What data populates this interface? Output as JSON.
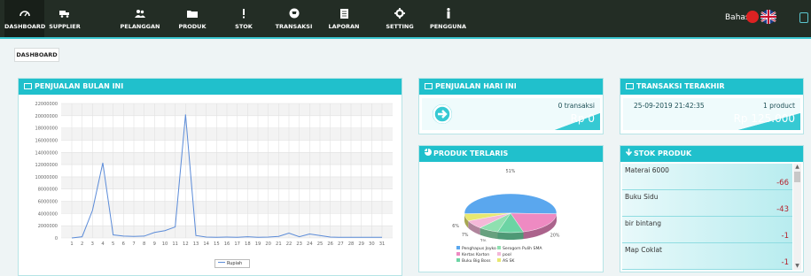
{
  "nav": {
    "items": [
      {
        "label": "DASHBOARD",
        "icon": "dashboard-icon"
      },
      {
        "label": "SUPPLIER",
        "icon": "truck-icon"
      },
      {
        "label": "PELANGGAN",
        "icon": "users-icon"
      },
      {
        "label": "PRODUK",
        "icon": "folder-icon"
      },
      {
        "label": "STOK",
        "icon": "exclamation-icon"
      },
      {
        "label": "TRANSAKSI",
        "icon": "cart-icon"
      },
      {
        "label": "LAPORAN",
        "icon": "document-icon"
      },
      {
        "label": "SETTING",
        "icon": "gear-icon"
      },
      {
        "label": "PENGGUNA",
        "icon": "user-icon"
      }
    ],
    "language_label": "Bahasa"
  },
  "breadcrumb": "DASHBOARD",
  "panels": {
    "monthly_sales_title": "PENJUALAN BULAN INI",
    "today_sales_title": "PENJUALAN HARI INI",
    "last_tx_title": "TRANSAKSI TERAKHIR",
    "best_products_title": "PRODUK TERLARIS",
    "stock_title": "STOK PRODUK"
  },
  "today_sales": {
    "count": "0 transaksi",
    "amount": "Rp 0"
  },
  "last_transaction": {
    "date": "25-09-2019 21:42:35",
    "count": "1 product",
    "amount": "Rp 125.000"
  },
  "stock_items": [
    {
      "name": "Materai 6000",
      "qty": "-66"
    },
    {
      "name": "Buku Sidu",
      "qty": "-43"
    },
    {
      "name": "bir bintang",
      "qty": "-1"
    },
    {
      "name": "Map Coklat",
      "qty": "-1"
    }
  ],
  "chart_data": [
    {
      "type": "line",
      "x": [
        1,
        2,
        3,
        4,
        5,
        6,
        7,
        8,
        9,
        10,
        11,
        12,
        13,
        14,
        15,
        16,
        17,
        18,
        19,
        20,
        21,
        22,
        23,
        24,
        25,
        26,
        27,
        28,
        29,
        30,
        31
      ],
      "series": [
        {
          "name": "Rupiah",
          "color": "#5b8bd8",
          "values": [
            0,
            200000,
            4500000,
            12300000,
            500000,
            300000,
            250000,
            300000,
            900000,
            1200000,
            1800000,
            20200000,
            400000,
            150000,
            100000,
            150000,
            100000,
            200000,
            100000,
            150000,
            250000,
            800000,
            200000,
            650000,
            400000,
            150000,
            100000,
            100000,
            100000,
            100000,
            100000
          ]
        }
      ],
      "y_ticks": [
        "0",
        "2000000",
        "4000000",
        "6000000",
        "8000000",
        "10000000",
        "12000000",
        "14000000",
        "16000000",
        "18000000",
        "20000000",
        "22000000"
      ],
      "ylim": [
        0,
        22000000
      ],
      "grid": true,
      "legend": "bottom-center"
    },
    {
      "type": "pie",
      "slices": [
        {
          "label": "Penghapus Joyko",
          "value": 51,
          "color": "#5aa7ee",
          "text": "51%"
        },
        {
          "label": "Kertas Karton",
          "value": 20,
          "color": "#ee8ac2",
          "text": "20%"
        },
        {
          "label": "Buku Big Boss",
          "value": 9,
          "color": "#6cd4a4",
          "text": "9%"
        },
        {
          "label": "Serogom Pulih SMA",
          "value": 7,
          "color": "#8fe0b0",
          "text": "7%"
        },
        {
          "label": "pool",
          "value": 7,
          "color": "#f4b8d8",
          "text": "7%"
        },
        {
          "label": "AS SK",
          "value": 6,
          "color": "#e8e870",
          "text": "6%"
        }
      ],
      "legend": "bottom"
    }
  ]
}
